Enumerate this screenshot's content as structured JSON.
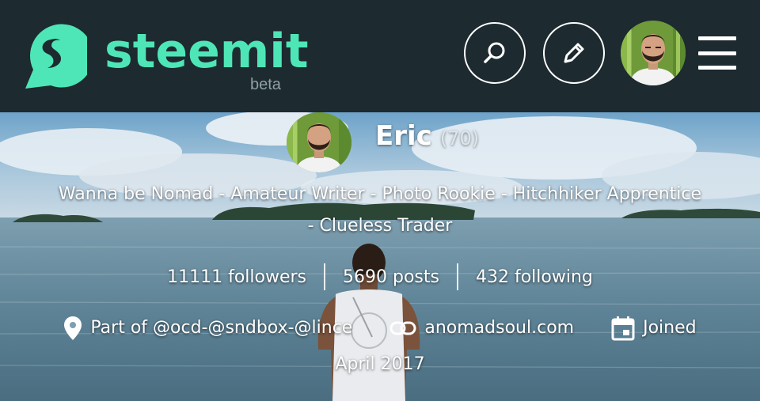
{
  "header": {
    "logo_text": "steemit",
    "logo_badge": "beta",
    "brand_color": "#4ee6b7",
    "bar_color": "#1d2a30",
    "icons": [
      "steemit-logo-icon",
      "search-icon",
      "pencil-icon",
      "user-avatar",
      "hamburger-menu-icon"
    ]
  },
  "profile": {
    "name": "Eric",
    "reputation": "(70)",
    "about_line1": "Wanna be Nomad - Amateur Writer - Photo Rookie - Hitchhiker Apprentice",
    "about_line2": "- Clueless Trader",
    "stats": {
      "followers": "11111 followers",
      "posts": "5690 posts",
      "following": "432 following"
    },
    "location": "Part of @ocd-@sndbox-@lince",
    "website": "anomadsoul.com",
    "joined_label": "Joined",
    "joined_date": "April 2017",
    "meta_icons": [
      "location-pin-icon",
      "link-icon",
      "calendar-icon"
    ]
  }
}
